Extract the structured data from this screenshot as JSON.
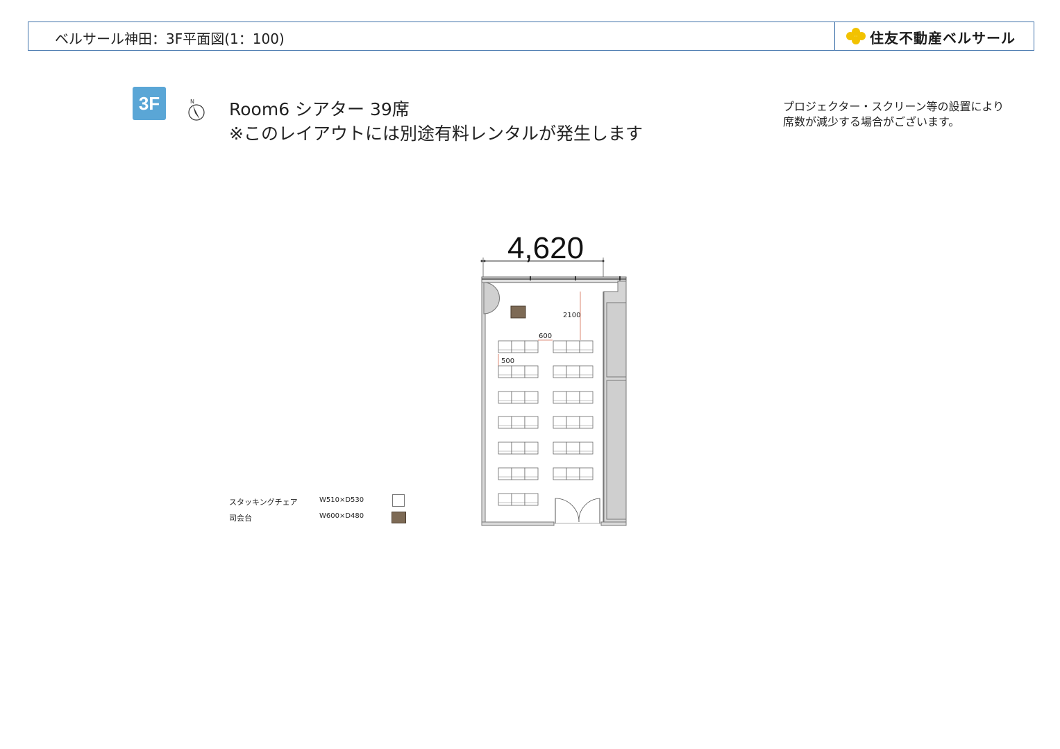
{
  "header": {
    "title": "ベルサール神田：3F平面図(1：100)",
    "brand": "住友不動産ベルサール"
  },
  "floor_badge": "3F",
  "north_label": "N",
  "room": {
    "title_line1": "Room6 シアター 39席",
    "title_line2": "※このレイアウトには別途有料レンタルが発生します"
  },
  "note": {
    "line1": "プロジェクター・スクリーン等の設置により",
    "line2": "席数が減少する場合がございます。"
  },
  "dimensions": {
    "width": "4,620",
    "d2100": "2100",
    "d600": "600",
    "d500": "500"
  },
  "legend": {
    "items": [
      {
        "name": "スタッキングチェア",
        "size": "W510×D530",
        "icon": "chair-icon"
      },
      {
        "name": "司会台",
        "size": "W600×D480",
        "icon": "podium-icon"
      }
    ]
  },
  "colors": {
    "header_border": "#3a6ea8",
    "badge_bg": "#5aa6d6",
    "logo_yellow": "#f2c200",
    "wall": "#8a8a8a",
    "wall_fill": "#d9d9d9",
    "podium": "#7d6a55",
    "dimension_red": "#d46a50"
  },
  "layout_info": {
    "seat_rows": 7,
    "seats_per_block_row": 3,
    "blocks": 2
  }
}
